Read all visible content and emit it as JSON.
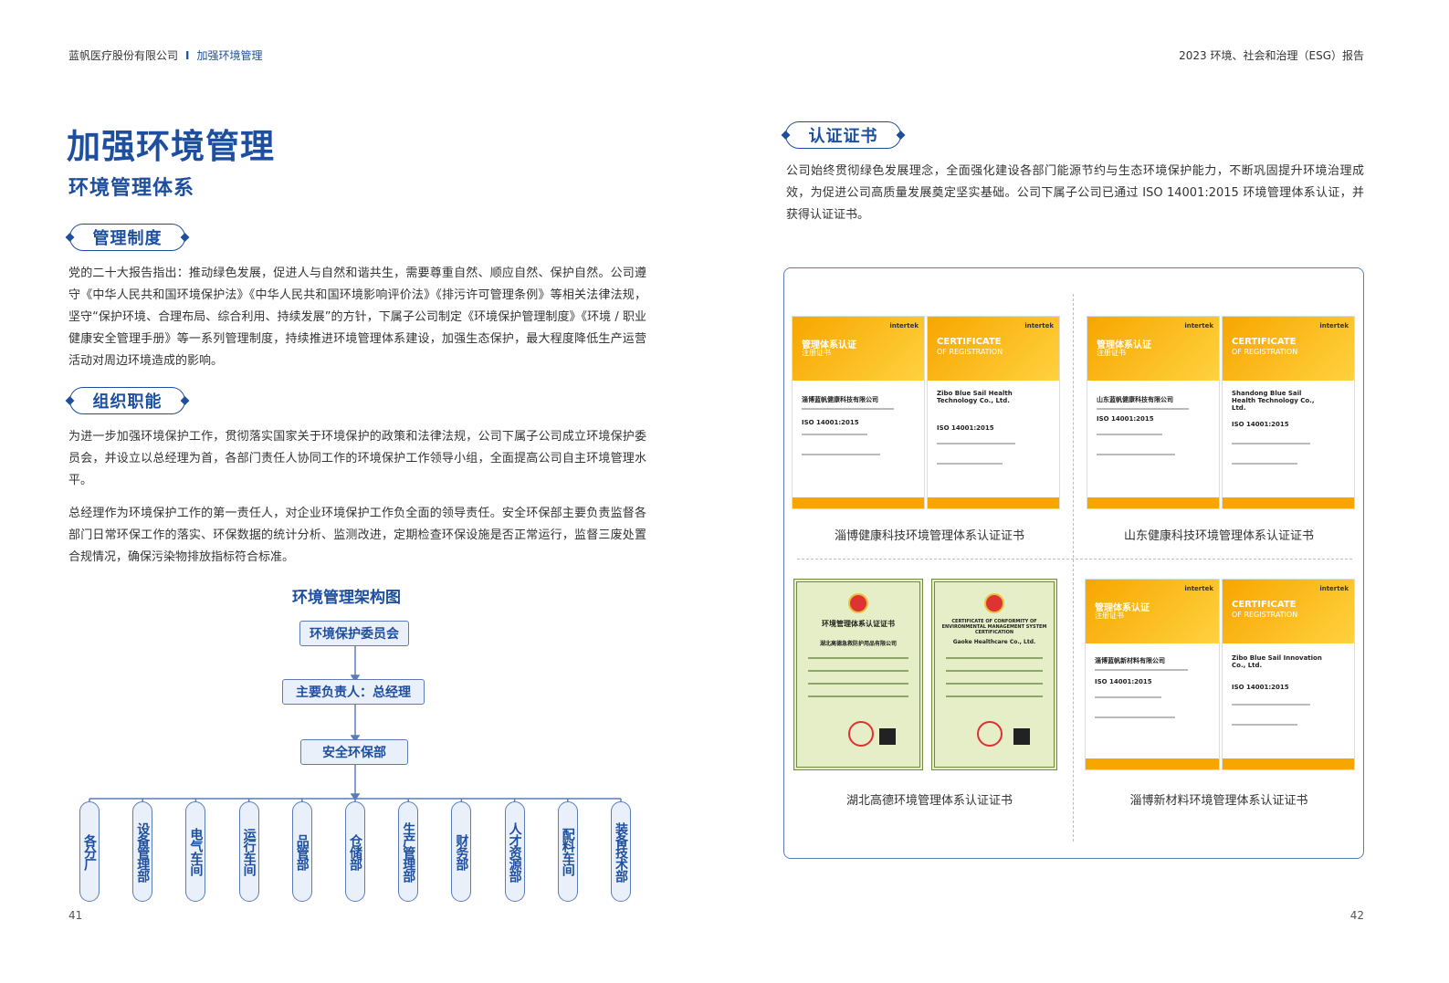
{
  "header": {
    "company": "蓝帆医疗股份有限公司",
    "separator": "I",
    "section": "加强环境管理",
    "report": "2023 环境、社会和治理（ESG）报告"
  },
  "left": {
    "title": "加强环境管理",
    "subtitle": "环境管理体系",
    "sec1": {
      "label": "管理制度",
      "text": "党的二十大报告指出：推动绿色发展，促进人与自然和谐共生，需要尊重自然、顺应自然、保护自然。公司遵守《中华人民共和国环境保护法》《中华人民共和国环境影响评价法》《排污许可管理条例》等相关法律法规，坚守“保护环境、合理布局、综合利用、持续发展”的方针，下属子公司制定《环境保护管理制度》《环境 / 职业健康安全管理手册》等一系列管理制度，持续推进环境管理体系建设，加强生态保护，最大程度降低生产运营活动对周边环境造成的影响。"
    },
    "sec2": {
      "label": "组织职能",
      "text1": "为进一步加强环境保护工作，贯彻落实国家关于环境保护的政策和法律法规，公司下属子公司成立环境保护委员会，并设立以总经理为首，各部门责任人协同工作的环境保护工作领导小组，全面提高公司自主环境管理水平。",
      "text2": "总经理作为环境保护工作的第一责任人，对企业环境保护工作负全面的领导责任。安全环保部主要负责监督各部门日常环保工作的落实、环保数据的统计分析、监测改进，定期检查环保设施是否正常运行，监督三废处置合规情况，确保污染物排放指标符合标准。"
    },
    "org": {
      "title": "环境管理架构图",
      "top": "环境保护委员会",
      "mid": "主要负责人：总经理",
      "dept": "安全环保部",
      "units": [
        "各分厂",
        "设备管理部",
        "电气车间",
        "运行车间",
        "品管部",
        "仓储部",
        "生产管理部",
        "财务部",
        "人才资源部",
        "配料车间",
        "装备技术部"
      ]
    },
    "page": "41"
  },
  "right": {
    "sec": {
      "label": "认证证书",
      "text": "公司始终贯彻绿色发展理念，全面强化建设各部门能源节约与生态环境保护能力，不断巩固提升环境治理成效，为促进公司高质量发展奠定坚实基础。公司下属子公司已通过 ISO 14001:2015 环境管理体系认证，并获得认证证书。"
    },
    "certs": [
      {
        "caption": "淄博健康科技环境管理体系认证证书",
        "cn_title": "管理体系认证",
        "cn_sub": "注册证书",
        "en_title": "CERTIFICATE",
        "en_sub": "OF REGISTRATION",
        "brand": "intertek",
        "company_cn": "淄博蓝帆健康科技有限公司",
        "company_en": "Zibo Blue Sail Health Technology Co., Ltd.",
        "std": "ISO 14001:2015"
      },
      {
        "caption": "山东健康科技环境管理体系认证证书",
        "cn_title": "管理体系认证",
        "cn_sub": "注册证书",
        "en_title": "CERTIFICATE",
        "en_sub": "OF REGISTRATION",
        "brand": "intertek",
        "company_cn": "山东蓝帆健康科技有限公司",
        "company_en": "Shandong Blue Sail Health Technology Co., Ltd.",
        "std": "ISO 14001:2015"
      },
      {
        "caption": "湖北高德环境管理体系认证证书",
        "cn_title": "环境管理体系认证证书",
        "en_title": "CERTIFICATE OF CONFORMITY OF ENVIRONMENTAL MANAGEMENT SYSTEM CERTIFICATION",
        "company_cn": "湖北高德急救防护用品有限公司",
        "company_en": "Gaoke Healthcare Co., Ltd."
      },
      {
        "caption": "淄博新材料环境管理体系认证证书",
        "cn_title": "管理体系认证",
        "cn_sub": "注册证书",
        "en_title": "CERTIFICATE",
        "en_sub": "OF REGISTRATION",
        "brand": "intertek",
        "company_cn": "淄博蓝帆新材料有限公司",
        "company_en": "Zibo Blue Sail Innovation Co., Ltd.",
        "std": "ISO 14001:2015"
      }
    ],
    "page": "42"
  }
}
